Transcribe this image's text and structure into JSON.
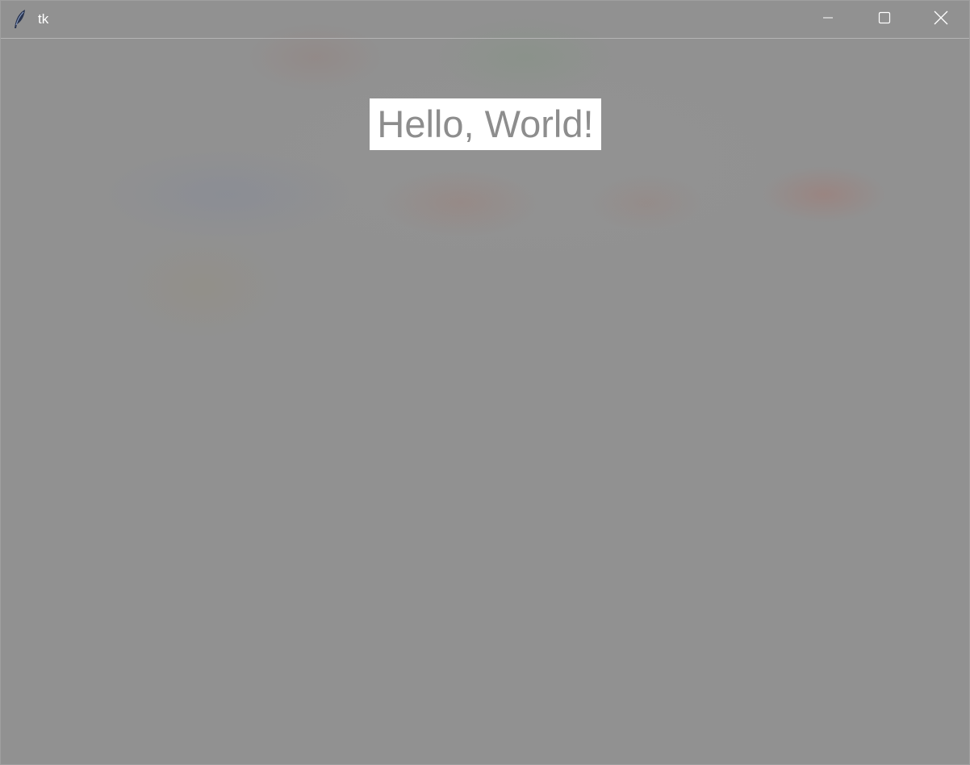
{
  "window": {
    "title": "tk",
    "background_color": "#919191"
  },
  "titlebar": {
    "app_icon": "feather-icon",
    "buttons": [
      {
        "name": "minimize",
        "icon": "minimize-icon"
      },
      {
        "name": "maximize",
        "icon": "maximize-icon"
      },
      {
        "name": "close",
        "icon": "close-icon"
      }
    ]
  },
  "main": {
    "label_text": "Hello, World!",
    "label_background": "#ffffff",
    "label_text_color": "#8d8d8d"
  }
}
